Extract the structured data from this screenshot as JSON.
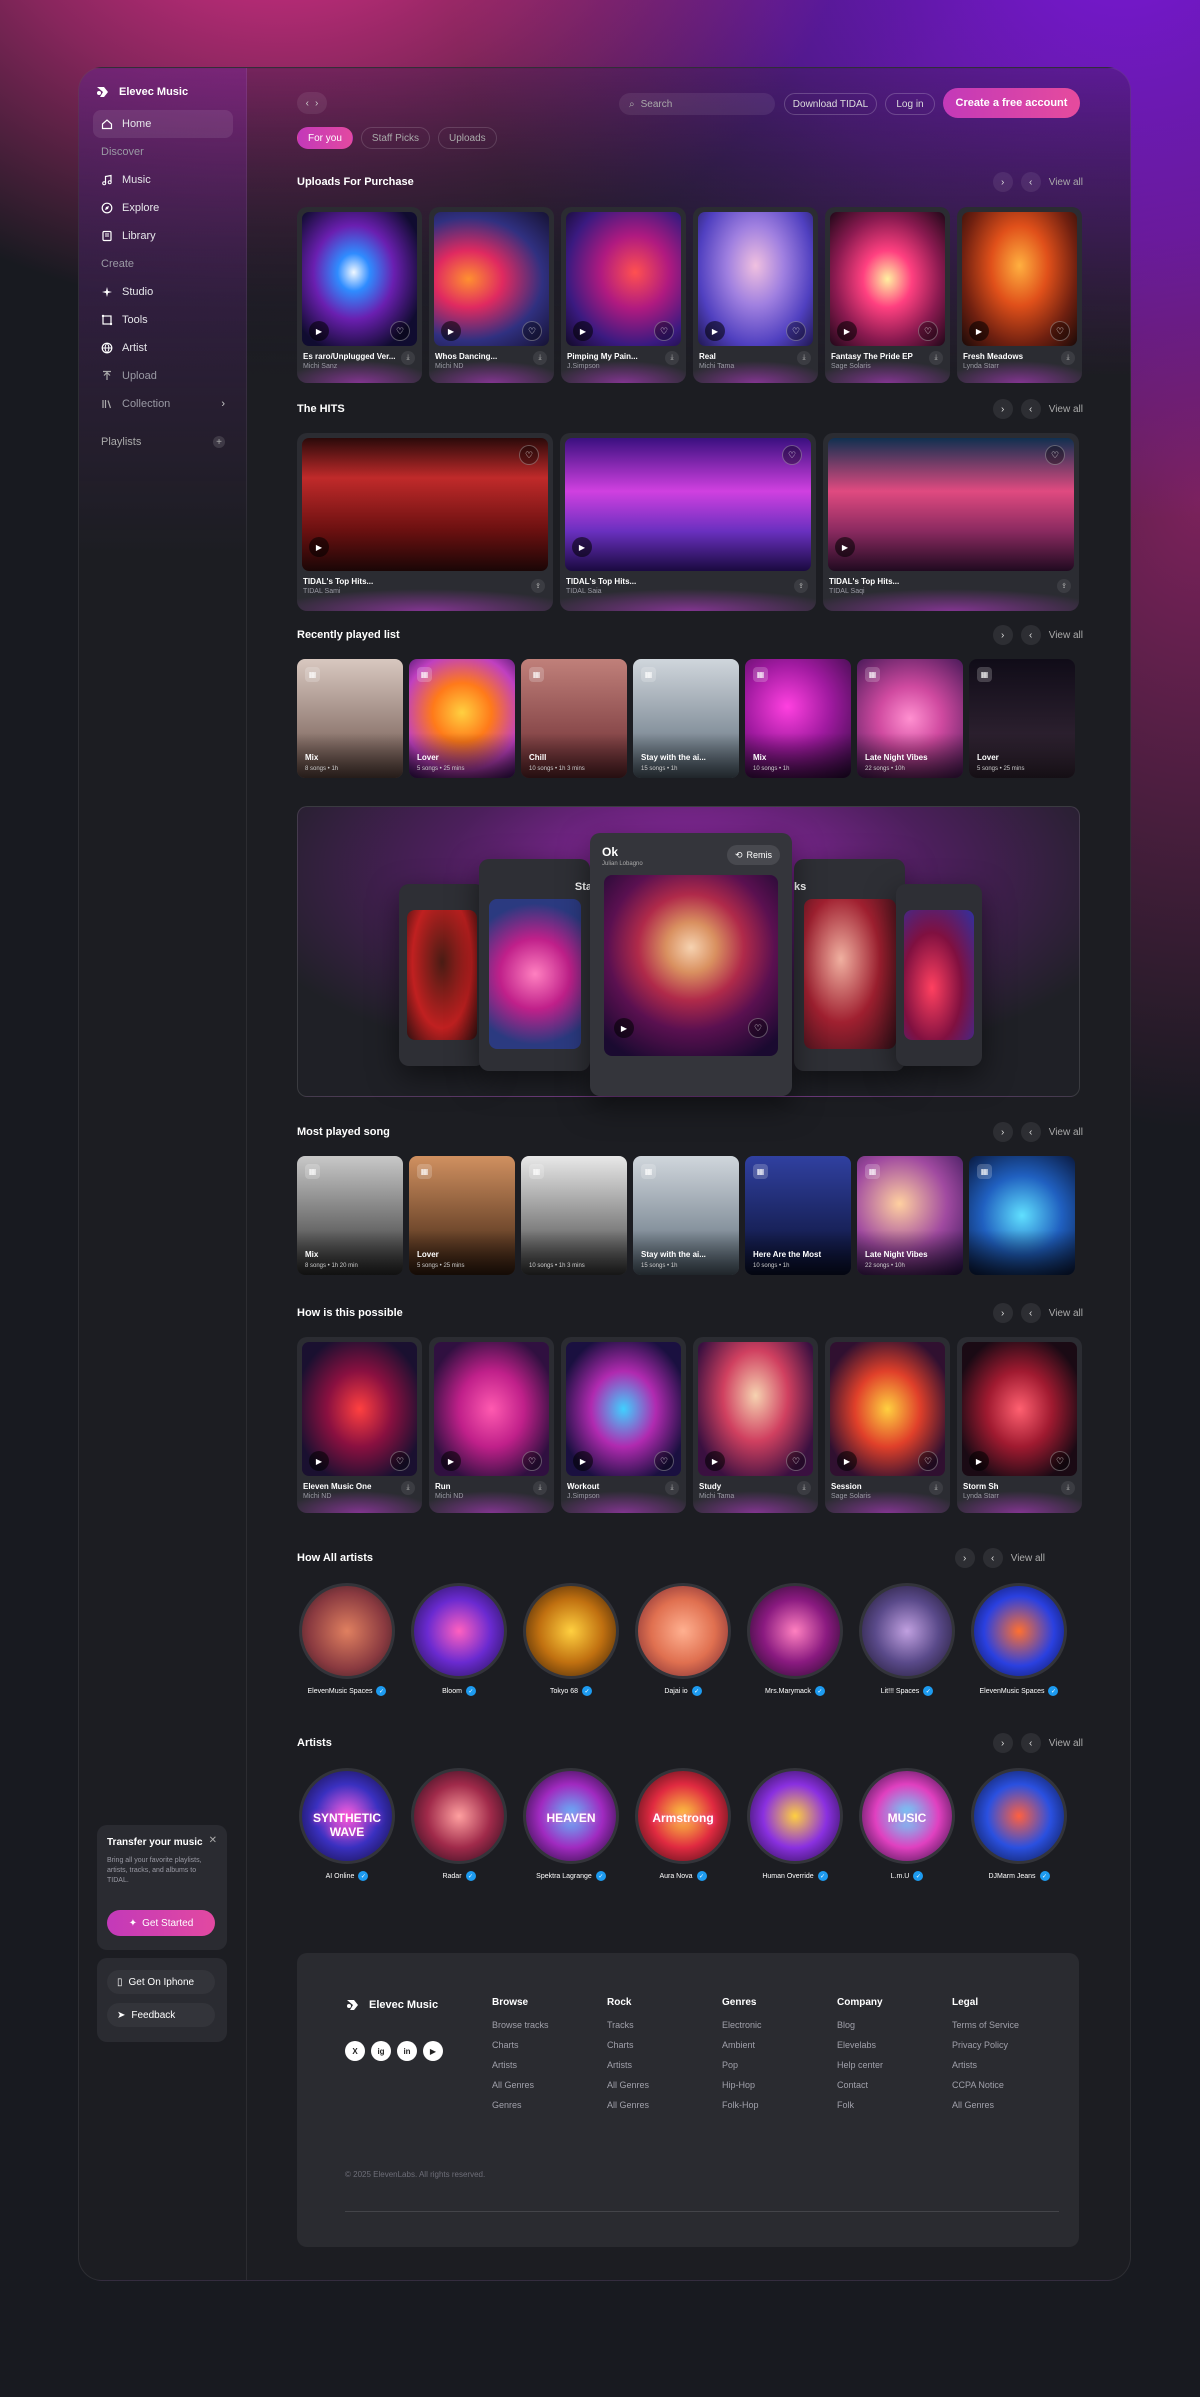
{
  "brand": {
    "name": "Elevec Music"
  },
  "sidebar": {
    "home": "Home",
    "sec_discover": "Discover",
    "music": "Music",
    "explore": "Explore",
    "library": "Library",
    "sec_create": "Create",
    "studio": "Studio",
    "tools": "Tools",
    "artist": "Artist",
    "upload": "Upload",
    "collection": "Collection",
    "playlists": "Playlists"
  },
  "transfer": {
    "title": "Transfer your music",
    "body": "Bring all your favorite playlists, artists, tracks, and albums to TIDAL.",
    "cta": "Get Started"
  },
  "app": {
    "iphone": "Get On Iphone",
    "feedback": "Feedback"
  },
  "topbar": {
    "search_placeholder": "Search",
    "download": "Download TIDAL",
    "login": "Log in",
    "create": "Create a free account"
  },
  "tabs": [
    "For you",
    "Staff Picks",
    "Uploads"
  ],
  "view_all": "View all",
  "uploads": {
    "title": "Uploads For Purchase",
    "items": [
      {
        "title": "Es raro/Unplugged Ver...",
        "artist": "Michi Sanz"
      },
      {
        "title": "Whos Dancing...",
        "artist": "Michi ND"
      },
      {
        "title": "Pimping My Pain...",
        "artist": "J.Simpson"
      },
      {
        "title": "Real",
        "artist": "Michi Tama"
      },
      {
        "title": "Fantasy The Pride EP",
        "artist": "Sage Solaris"
      },
      {
        "title": "Fresh Meadows",
        "artist": "Lynda Starr"
      }
    ]
  },
  "hits": {
    "title": "The HITS",
    "items": [
      {
        "title": "TIDAL's Top Hits...",
        "artist": "TIDAL Sami"
      },
      {
        "title": "TIDAL's Top Hits...",
        "artist": "TIDAL Saia"
      },
      {
        "title": "TIDAL's Top Hits...",
        "artist": "TIDAL Saqi"
      }
    ]
  },
  "recent": {
    "title": "Recently played list",
    "items": [
      {
        "title": "Mix",
        "sub": "8 songs • 1h"
      },
      {
        "title": "Lover",
        "sub": "5 songs • 25 mins"
      },
      {
        "title": "Chill",
        "sub": "10 songs • 1h 3 mins"
      },
      {
        "title": "Stay with the ai...",
        "sub": "15 songs • 1h"
      },
      {
        "title": "Mix",
        "sub": "10 songs • 1h"
      },
      {
        "title": "Late Night Vibes",
        "sub": "22 songs • 10h"
      },
      {
        "title": "Lover",
        "sub": "5 songs • 25 mins"
      }
    ]
  },
  "showcase": {
    "title": "Ok",
    "artist": "Julian Lobagno",
    "remix": "Remis",
    "left_label": "Sta",
    "right_label": "ks"
  },
  "most": {
    "title": "Most played song",
    "items": [
      {
        "title": "Mix",
        "sub": "8 songs • 1h 20 min"
      },
      {
        "title": "Lover",
        "sub": "5 songs • 25 mins"
      },
      {
        "title": "",
        "sub": "10 songs • 1h 3 mins"
      },
      {
        "title": "Stay with the ai...",
        "sub": "15 songs • 1h"
      },
      {
        "title": "Here Are the Most",
        "sub": "10 songs • 1h"
      },
      {
        "title": "Late Night Vibes",
        "sub": "22 songs • 10h"
      },
      {
        "title": "",
        "sub": ""
      }
    ]
  },
  "possible": {
    "title": "How is this possible",
    "items": [
      {
        "title": "Eleven Music One",
        "artist": "Michi ND"
      },
      {
        "title": "Run",
        "artist": "Michi ND"
      },
      {
        "title": "Workout",
        "artist": "J.Simpson"
      },
      {
        "title": "Study",
        "artist": "Michi Tama"
      },
      {
        "title": "Session",
        "artist": "Sage Solaris"
      },
      {
        "title": "Storm Sh",
        "artist": "Lynda Starr"
      }
    ]
  },
  "allartists": {
    "title": "How All artists",
    "items": [
      "ElevenMusic Spaces",
      "Bloom",
      "Tokyo 68",
      "Dajai io",
      "Mrs.Marymack",
      "Lit!!! Spaces",
      "ElevenMusic Spaces"
    ]
  },
  "artists": {
    "title": "Artists",
    "items": [
      "AI Online",
      "Radar",
      "Spektra Lagrange",
      "Aura Nova",
      "Human Override",
      "L.m.U",
      "DJMarm Jeans"
    ],
    "texts": [
      "SYNTHETIC WAVE",
      "",
      "HEAVEN",
      "Armstrong",
      "",
      "MUSIC",
      ""
    ]
  },
  "footer": {
    "brand": "Elevec Music",
    "cols": [
      {
        "h": "Browse",
        "items": [
          "Browse tracks",
          "Charts",
          "Artists",
          "All Genres",
          "Genres"
        ]
      },
      {
        "h": "Rock",
        "items": [
          "Tracks",
          "Charts",
          "Artists",
          "All Genres",
          "All Genres"
        ]
      },
      {
        "h": "Genres",
        "items": [
          "Electronic",
          "Ambient",
          "Pop",
          "Hip-Hop",
          "Folk-Hop"
        ]
      },
      {
        "h": "Company",
        "items": [
          "Blog",
          "Elevelabs",
          "Help center",
          "Contact",
          "Folk"
        ]
      },
      {
        "h": "Legal",
        "items": [
          "Terms of Service",
          "Privacy Policy",
          "Artists",
          "CCPA Notice",
          "All Genres"
        ]
      }
    ],
    "social": [
      "X",
      "ig",
      "in",
      "▶"
    ],
    "copyright": "© 2025 ElevenLabs. All rights reserved."
  }
}
